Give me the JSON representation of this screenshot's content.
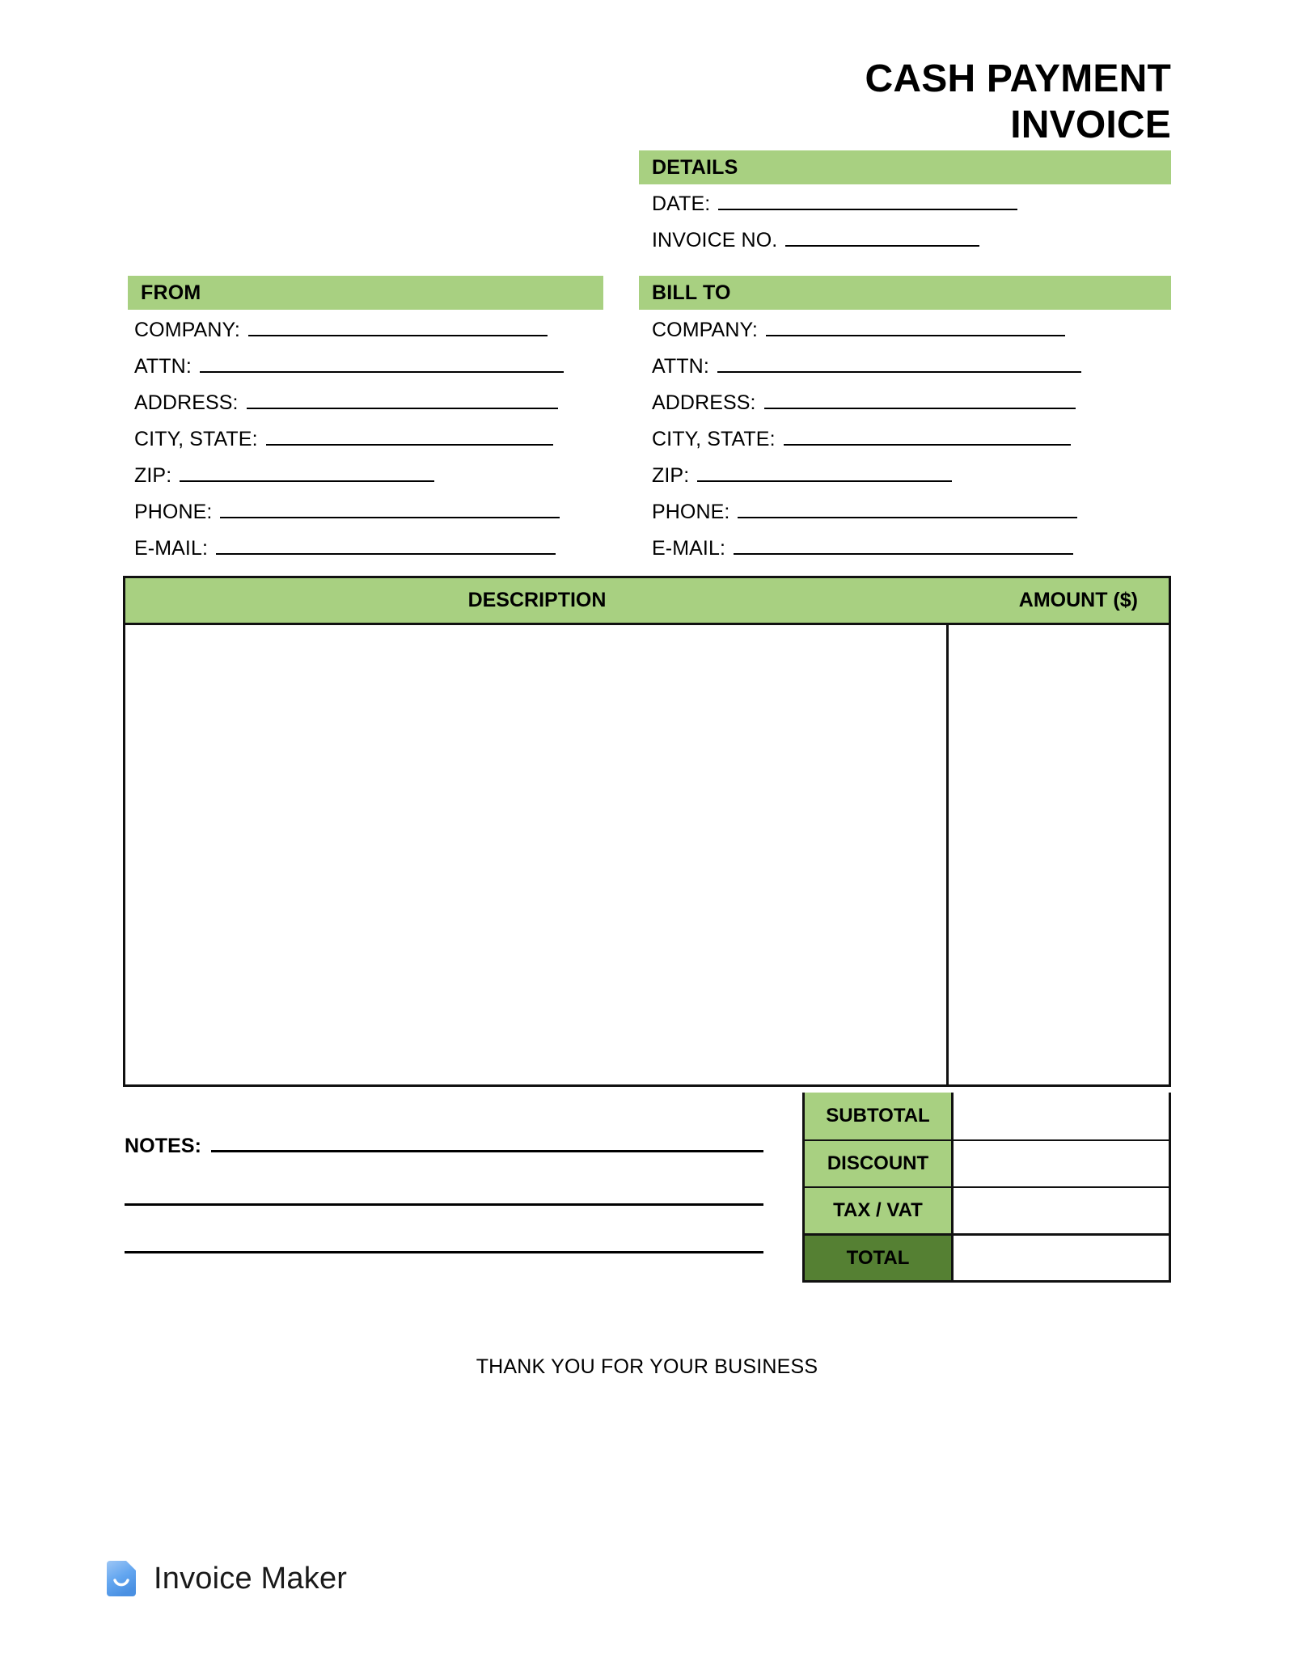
{
  "document": {
    "title_lines": [
      "CASH PAYMENT",
      "INVOICE"
    ]
  },
  "colors": {
    "accent_light_green": "#a8d081",
    "accent_dark_green": "#558033",
    "border": "#111111",
    "brand_blue": "#4a90e2"
  },
  "details": {
    "heading": "DETAILS",
    "fields": [
      {
        "label": "DATE:"
      },
      {
        "label": "INVOICE NO."
      }
    ]
  },
  "from": {
    "heading": "FROM",
    "fields": [
      {
        "label": "COMPANY:"
      },
      {
        "label": "ATTN:"
      },
      {
        "label": "ADDRESS:"
      },
      {
        "label": "CITY, STATE:"
      },
      {
        "label": "ZIP:"
      },
      {
        "label": "PHONE:"
      },
      {
        "label": "E-MAIL:"
      }
    ]
  },
  "bill_to": {
    "heading": "BILL TO",
    "fields": [
      {
        "label": "COMPANY:"
      },
      {
        "label": "ATTN:"
      },
      {
        "label": "ADDRESS:"
      },
      {
        "label": "CITY, STATE:"
      },
      {
        "label": "ZIP:"
      },
      {
        "label": "PHONE:"
      },
      {
        "label": "E-MAIL:"
      }
    ]
  },
  "items_table": {
    "columns": [
      {
        "label": "DESCRIPTION"
      },
      {
        "label": "AMOUNT ($)"
      }
    ],
    "rows": []
  },
  "totals": {
    "rows": [
      {
        "label": "SUBTOTAL",
        "value": ""
      },
      {
        "label": "DISCOUNT",
        "value": ""
      },
      {
        "label": "TAX / VAT",
        "value": ""
      },
      {
        "label": "TOTAL",
        "value": ""
      }
    ]
  },
  "notes": {
    "label": "NOTES:",
    "value": "",
    "extra_lines": 2
  },
  "footer": {
    "thank_you": "THANK YOU FOR YOUR BUSINESS",
    "brand_name": "Invoice Maker",
    "brand_icon": "document-smile-icon"
  }
}
